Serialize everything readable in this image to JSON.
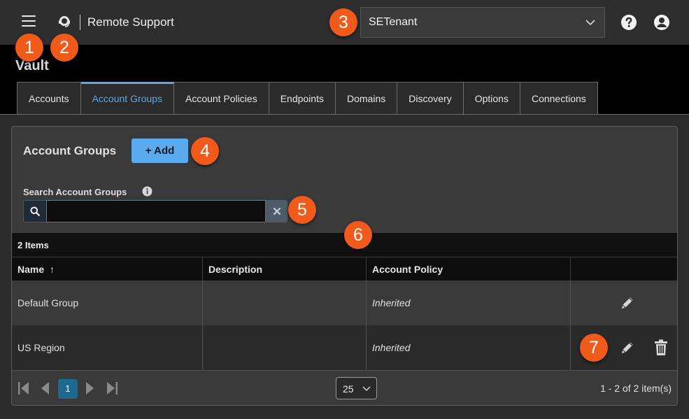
{
  "header": {
    "app_title": "Remote Support",
    "tenant": "SETenant"
  },
  "page": {
    "title": "Vault"
  },
  "tabs": [
    {
      "label": "Accounts"
    },
    {
      "label": "Account Groups"
    },
    {
      "label": "Account Policies"
    },
    {
      "label": "Endpoints"
    },
    {
      "label": "Domains"
    },
    {
      "label": "Discovery"
    },
    {
      "label": "Options"
    },
    {
      "label": "Connections"
    }
  ],
  "panel": {
    "title": "Account Groups",
    "add_label": "+ Add",
    "search_label": "Search Account Groups",
    "search_value": "",
    "items_count": "2 Items"
  },
  "table": {
    "columns": [
      "Name",
      "Description",
      "Account Policy"
    ],
    "sort_indicator": "↑",
    "rows": [
      {
        "name": "Default Group",
        "description": "",
        "policy": "Inherited"
      },
      {
        "name": "US Region",
        "description": "",
        "policy": "Inherited"
      }
    ]
  },
  "pager": {
    "current_page": "1",
    "page_size": "25",
    "range": "1 - 2 of 2 item(s)"
  },
  "callouts": [
    "1",
    "2",
    "3",
    "4",
    "5",
    "6",
    "7"
  ],
  "colors": {
    "accent": "#5aa9e6",
    "callout": "#f05a1a",
    "active_page": "#1d6a8e"
  }
}
